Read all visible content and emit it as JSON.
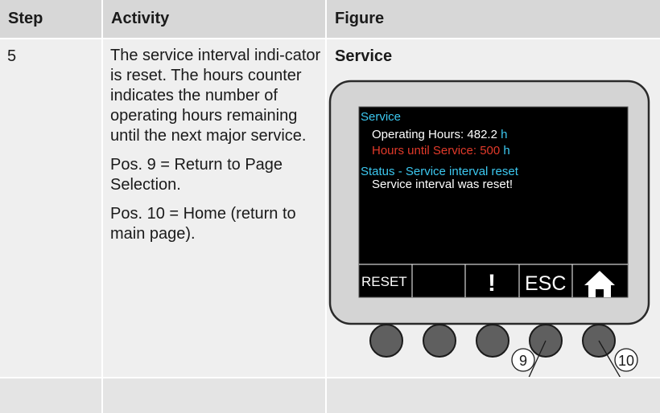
{
  "table": {
    "headers": {
      "step": "Step",
      "activity": "Activity",
      "figure": "Figure"
    },
    "row": {
      "step": "5",
      "activity_paragraphs": [
        "The service interval indi-cator is reset. The hours counter indicates the number of operating hours remaining until the next major service.",
        "Pos. 9 = Return to Page Selection.",
        "Pos. 10 = Home (return to main page)."
      ],
      "figure_title": "Service"
    }
  },
  "display": {
    "title": "Service",
    "operating_hours_label": "Operating Hours: 482.2",
    "operating_hours_unit": "h",
    "hours_until_label": "Hours until Service:  500",
    "hours_until_unit": "h",
    "status_title": "Status - Service interval reset",
    "status_message": "Service interval was reset!",
    "softkeys": [
      "RESET",
      "",
      "!",
      "ESC",
      "home-icon"
    ]
  },
  "callouts": [
    "9",
    "10"
  ],
  "colors": {
    "screen_bg": "#000000",
    "cyan_text": "#3cc8f0",
    "red_text": "#e23a2a",
    "panel_bg": "#d4d4d4",
    "button_fill": "#5f5f5f"
  }
}
